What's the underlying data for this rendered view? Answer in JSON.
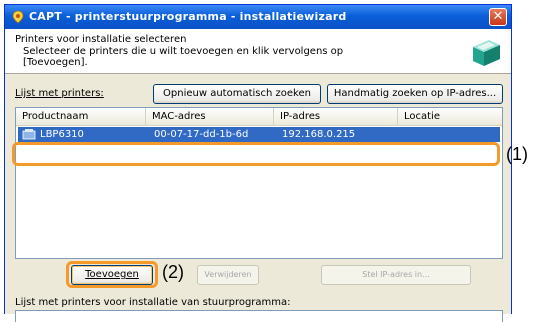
{
  "window": {
    "title": "CAPT - printerstuurprogramma - installatiewizard",
    "close_glyph": "✕"
  },
  "header": {
    "title": "Printers voor installatie selecteren",
    "subtitle": "Selecteer de printers die u wilt toevoegen en klik vervolgens op [Toevoegen]."
  },
  "toolbar": {
    "list_label": "Lijst met printers:",
    "auto_search_label": "Opnieuw automatisch zoeken",
    "manual_search_label": "Handmatig zoeken op IP-adres..."
  },
  "printer_list": {
    "columns": [
      "Productnaam",
      "MAC-adres",
      "IP-adres",
      "Locatie"
    ],
    "rows": [
      {
        "product": "LBP6310",
        "mac": "00-07-17-dd-1b-6d",
        "ip": "192.168.0.215",
        "location": ""
      }
    ]
  },
  "actions": {
    "add_label": "Toevoegen",
    "remove_label": "Verwijderen",
    "set_ip_label": "Stel IP-adres in..."
  },
  "bottom": {
    "label": "Lijst met printers voor installatie van stuurprogramma:"
  },
  "callouts": {
    "one": "(1)",
    "two": "(2)"
  },
  "colors": {
    "title_bar": "#0a5fd8",
    "selection": "#316ac5",
    "callout": "#f39a2b"
  }
}
